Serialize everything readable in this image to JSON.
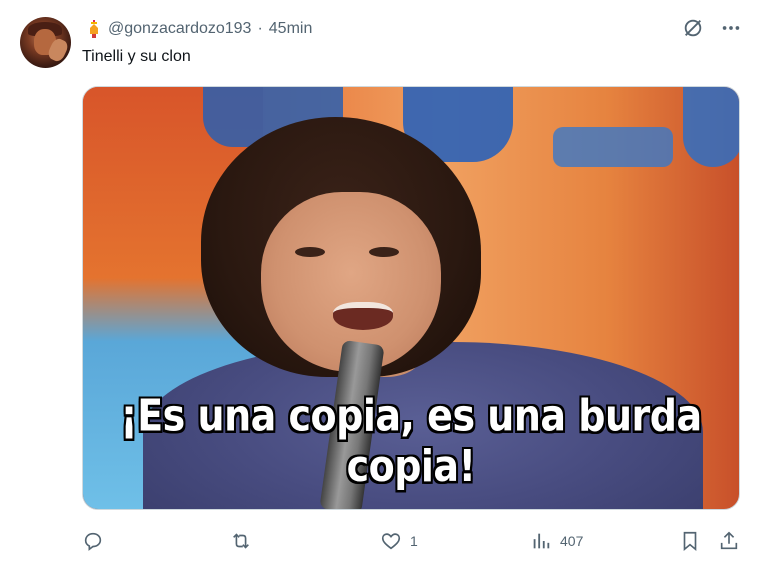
{
  "post": {
    "author": {
      "username": "@gonzacardozo193"
    },
    "separator": "·",
    "time": "45min",
    "text": "Tinelli y su clon",
    "media": {
      "caption": "¡Es una copia, es una burda copia!"
    },
    "stats": {
      "replies": "",
      "reposts": "",
      "likes": "1",
      "views": "407"
    }
  },
  "colors": {
    "text_primary": "#0f1419",
    "text_secondary": "#536471",
    "border": "#cfd9de"
  },
  "icons": [
    "badge-icon",
    "grok-icon",
    "more-icon",
    "reply-icon",
    "repost-icon",
    "like-icon",
    "views-icon",
    "bookmark-icon",
    "share-icon"
  ]
}
